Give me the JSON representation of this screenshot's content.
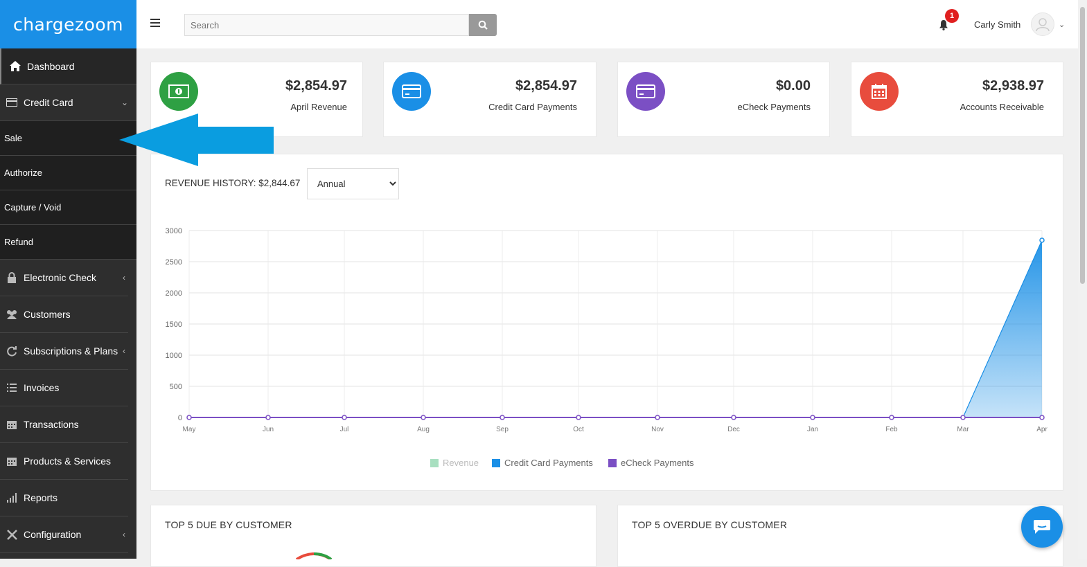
{
  "app": {
    "logo": "chargezoom"
  },
  "sidebar": {
    "items": [
      {
        "label": "Dashboard",
        "icon": "home-icon"
      },
      {
        "label": "Credit Card",
        "icon": "credit-card-icon"
      },
      {
        "label": "Electronic Check",
        "icon": "lock-icon"
      },
      {
        "label": "Customers",
        "icon": "users-icon"
      },
      {
        "label": "Subscriptions & Plans",
        "icon": "refresh-icon"
      },
      {
        "label": "Invoices",
        "icon": "list-icon"
      },
      {
        "label": "Transactions",
        "icon": "calendar-icon"
      },
      {
        "label": "Products & Services",
        "icon": "calendar-icon"
      },
      {
        "label": "Reports",
        "icon": "bar-chart-icon"
      },
      {
        "label": "Configuration",
        "icon": "wrench-icon"
      }
    ],
    "sub_items": [
      "Sale",
      "Authorize",
      "Capture / Void",
      "Refund"
    ]
  },
  "header": {
    "search_placeholder": "Search",
    "notification_count": "1",
    "user_name": "Carly Smith"
  },
  "cards": [
    {
      "value": "$2,854.97",
      "label": "April Revenue",
      "color": "#2ea043",
      "icon": "cash-icon"
    },
    {
      "value": "$2,854.97",
      "label": "Credit Card Payments",
      "color": "#1a8fe6",
      "icon": "credit-card-icon"
    },
    {
      "value": "$0.00",
      "label": "eCheck Payments",
      "color": "#7b4fc4",
      "icon": "credit-card-icon"
    },
    {
      "value": "$2,938.97",
      "label": "Accounts Receivable",
      "color": "#e84c3d",
      "icon": "calendar-icon"
    }
  ],
  "revenue": {
    "title": "REVENUE HISTORY: $2,844.67",
    "period": "Annual"
  },
  "chart_data": {
    "type": "area",
    "x": [
      "May",
      "Jun",
      "Jul",
      "Aug",
      "Sep",
      "Oct",
      "Nov",
      "Dec",
      "Jan",
      "Feb",
      "Mar",
      "Apr"
    ],
    "ylim": [
      0,
      3000
    ],
    "yticks": [
      0,
      500,
      1000,
      1500,
      2000,
      2500,
      3000
    ],
    "grid": true,
    "legend_position": "bottom",
    "series": [
      {
        "name": "Revenue",
        "color": "#a8dfc0",
        "values": [
          0,
          0,
          0,
          0,
          0,
          0,
          0,
          0,
          0,
          0,
          0,
          2844.67
        ]
      },
      {
        "name": "Credit Card Payments",
        "color": "#1a8fe6",
        "values": [
          0,
          0,
          0,
          0,
          0,
          0,
          0,
          0,
          0,
          0,
          0,
          2844.67
        ]
      },
      {
        "name": "eCheck Payments",
        "color": "#7b4fc4",
        "values": [
          0,
          0,
          0,
          0,
          0,
          0,
          0,
          0,
          0,
          0,
          0,
          0
        ]
      }
    ]
  },
  "bottom_panels": [
    "TOP 5 DUE BY CUSTOMER",
    "TOP 5 OVERDUE BY CUSTOMER"
  ]
}
